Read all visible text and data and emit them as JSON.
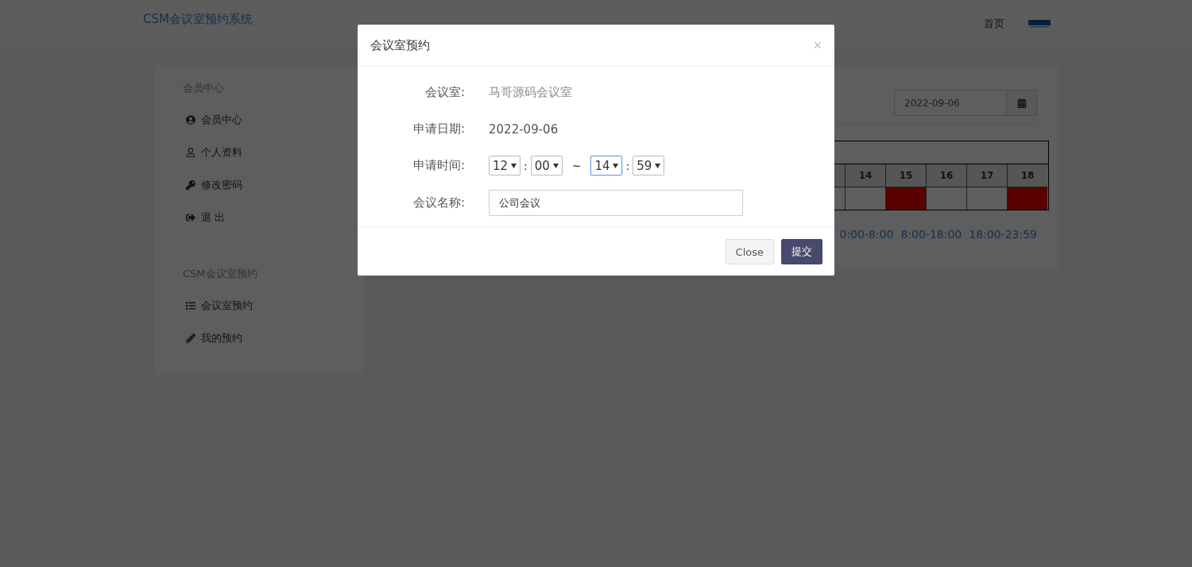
{
  "navbar": {
    "brand": "CSM会议室预约系统",
    "links": [
      {
        "label": "首页"
      }
    ]
  },
  "sidebar": {
    "sections": [
      {
        "title": "会员中心",
        "items": [
          {
            "label": "会员中心",
            "kind": "account"
          },
          {
            "label": "个人资料",
            "kind": "profile"
          },
          {
            "label": "修改密码",
            "kind": "password"
          },
          {
            "label": "退 出",
            "kind": "logout"
          }
        ]
      },
      {
        "title": "CSM会议室预约",
        "items": [
          {
            "label": "会议室预约",
            "kind": "list"
          },
          {
            "label": "我的预约",
            "kind": "edit"
          }
        ]
      }
    ]
  },
  "schedule": {
    "date": "2022-09-06",
    "hours": [
      {
        "label": "14",
        "booked": false
      },
      {
        "label": "15",
        "booked": true
      },
      {
        "label": "16",
        "booked": false
      },
      {
        "label": "17",
        "booked": false
      },
      {
        "label": "18",
        "booked": true
      }
    ],
    "legend": [
      "0:00-8:00",
      "8:00-18:00",
      "18:00-23:59"
    ]
  },
  "modal": {
    "title": "会议室预约",
    "close_glyph": "×",
    "fields": [
      {
        "kind": "text",
        "label": "会议室:",
        "value": "马哥源码会议室",
        "muted": true
      },
      {
        "kind": "text",
        "label": "申请日期:",
        "value": "2022-09-06",
        "muted": false
      },
      {
        "kind": "time",
        "label": "申请时间:",
        "selects": [
          {
            "value": "12",
            "focused": false
          },
          {
            "value": "00",
            "focused": false
          },
          {
            "value": "14",
            "focused": true
          },
          {
            "value": "59",
            "focused": false
          }
        ],
        "separators": [
          ":",
          "~",
          ":"
        ]
      },
      {
        "kind": "input",
        "label": "会议名称:",
        "value": "公司会议"
      }
    ],
    "buttons": [
      {
        "label": "Close",
        "kind": "default"
      },
      {
        "label": "提交",
        "kind": "primary"
      }
    ]
  }
}
